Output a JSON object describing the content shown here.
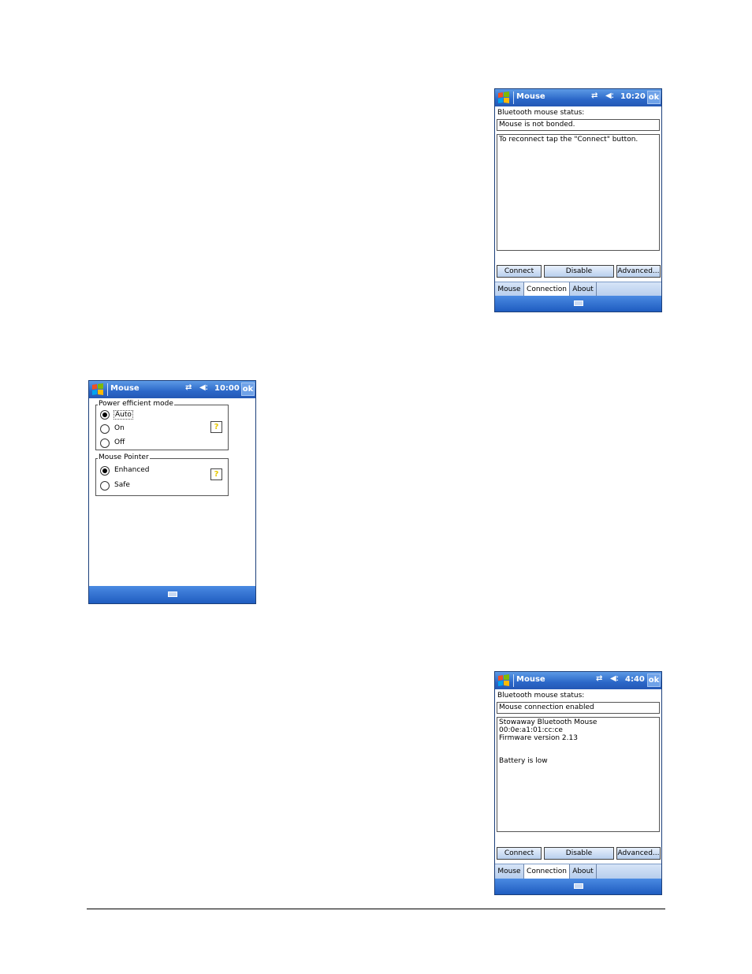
{
  "colors": {
    "titlebar": "#2b67c8",
    "accent": "#5d9be6"
  },
  "screen_top": {
    "title": "Mouse",
    "time": "10:20",
    "ok_label": "ok",
    "status_label": "Bluetooth mouse status:",
    "status_value": "Mouse is not bonded.",
    "info_text": "To reconnect tap the \"Connect\" button.",
    "buttons": {
      "connect": "Connect",
      "disable": "Disable",
      "advanced": "Advanced..."
    },
    "tabs": [
      "Mouse",
      "Connection",
      "About"
    ]
  },
  "screen_mid": {
    "title": "Mouse",
    "time": "10:00",
    "ok_label": "ok",
    "power_group": {
      "label": "Power efficient mode",
      "options": [
        "Auto",
        "On",
        "Off"
      ],
      "selected": "Auto"
    },
    "pointer_group": {
      "label": "Mouse Pointer",
      "options": [
        "Enhanced",
        "Safe"
      ],
      "selected": "Enhanced"
    },
    "help_glyph": "?"
  },
  "screen_bottom": {
    "title": "Mouse",
    "time": "4:40",
    "ok_label": "ok",
    "status_label": "Bluetooth mouse status:",
    "status_value": "Mouse connection enabled",
    "info_line1": "Stowaway Bluetooth Mouse 00:0e:a1:01:cc:ce",
    "info_line2": "Firmware version 2.13",
    "info_line3": "Battery is low",
    "buttons": {
      "connect": "Connect",
      "disable": "Disable",
      "advanced": "Advanced..."
    },
    "tabs": [
      "Mouse",
      "Connection",
      "About"
    ]
  },
  "icons": {
    "start": "windows-flag-icon",
    "connectivity": "connectivity-arrows-icon",
    "volume": "volume-muted-icon",
    "keyboard": "keyboard-icon"
  }
}
